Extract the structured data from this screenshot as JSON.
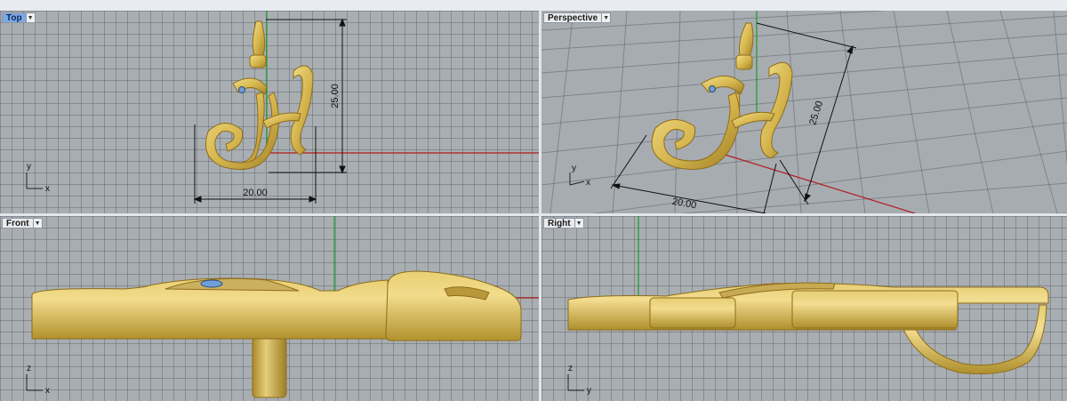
{
  "viewports": {
    "top": {
      "name": "Top",
      "active": true,
      "dims": {
        "width": "20.00",
        "height": "25.00"
      },
      "axes": {
        "x": "x",
        "y": "y"
      }
    },
    "perspective": {
      "name": "Perspective",
      "active": false,
      "dims": {
        "width": "20.00",
        "height": "25.00"
      },
      "axes": {
        "x": "x",
        "y": "y"
      }
    },
    "front": {
      "name": "Front",
      "active": false,
      "axes": {
        "x": "x",
        "z": "z"
      }
    },
    "right": {
      "name": "Right",
      "active": false,
      "axes": {
        "y": "y",
        "z": "z"
      }
    }
  },
  "colors": {
    "gold": "#d8bb55",
    "gold_dark": "#9b7a22",
    "gem": "#6f9ed6",
    "x_axis": "#b21c1c",
    "y_axis": "#1c9c2c",
    "grid_bg": "#a9aeb3"
  }
}
